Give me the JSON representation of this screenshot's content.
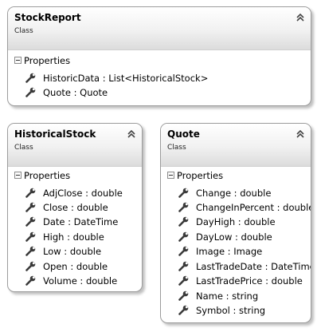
{
  "classes": [
    {
      "name": "StockReport",
      "kind": "Class",
      "section_label": "Properties",
      "properties": [
        "HistoricData : List<HistoricalStock>",
        "Quote : Quote"
      ]
    },
    {
      "name": "HistoricalStock",
      "kind": "Class",
      "section_label": "Properties",
      "properties": [
        "AdjClose : double",
        "Close : double",
        "Date : DateTime",
        "High : double",
        "Low : double",
        "Open : double",
        "Volume : double"
      ]
    },
    {
      "name": "Quote",
      "kind": "Class",
      "section_label": "Properties",
      "properties": [
        "Change : double",
        "ChangeInPercent : double",
        "DayHigh : double",
        "DayLow : double",
        "Image : Image",
        "LastTradeDate : DateTime",
        "LastTradePrice : double",
        "Name : string",
        "Symbol : string"
      ]
    }
  ],
  "icons": {
    "collapse": "double-chevron-up-icon",
    "property": "wrench-icon",
    "section_toggle": "minus-box-icon"
  }
}
